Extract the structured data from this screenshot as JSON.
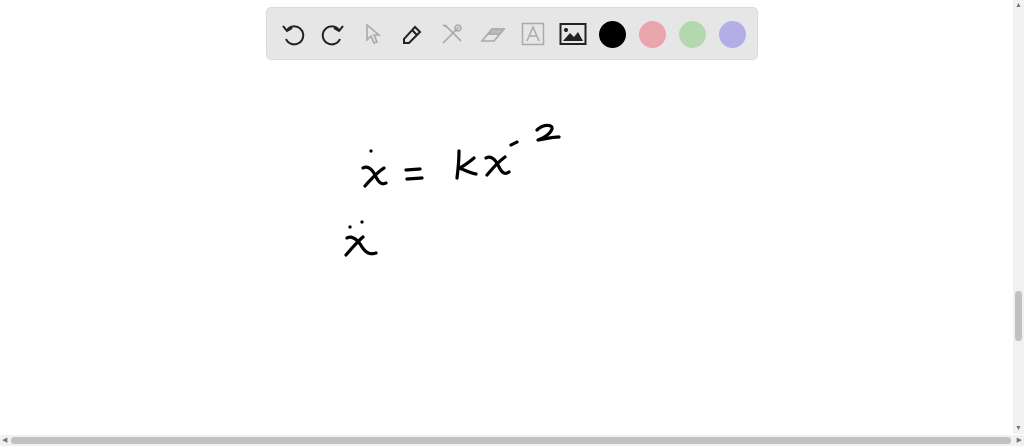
{
  "toolbar": {
    "tools": [
      "undo-icon",
      "redo-icon",
      "select-icon",
      "pen-icon",
      "tools-icon",
      "eraser-icon",
      "text-icon",
      "image-icon"
    ],
    "colors": {
      "black": "#000000",
      "pink": "#e8a5ac",
      "green": "#b3d8b0",
      "purple": "#b3ade8"
    }
  },
  "canvas": {
    "handwriting": [
      "ẋ = kx^-2",
      "ẍ"
    ]
  }
}
